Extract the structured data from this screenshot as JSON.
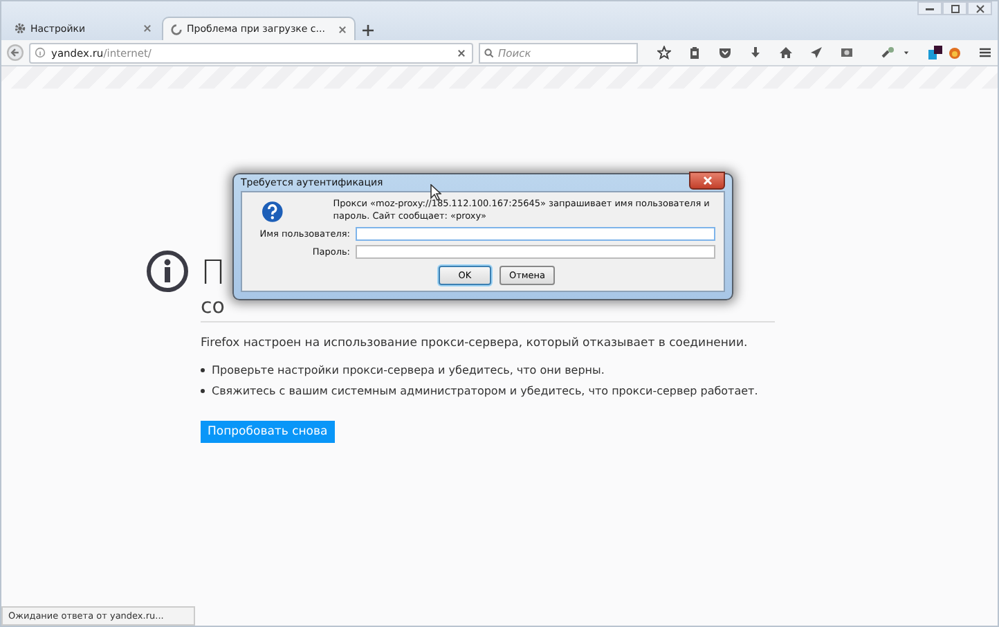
{
  "tabs": [
    {
      "title": "Настройки",
      "selected": false,
      "loading": false
    },
    {
      "title": "Проблема при загрузке с...",
      "selected": true,
      "loading": true
    }
  ],
  "address": {
    "host": "yandex.ru",
    "path": "/internet/"
  },
  "search": {
    "placeholder": "Поиск"
  },
  "page": {
    "heading": "П",
    "subheading": "со",
    "description": "Firefox настроен на использование прокси-сервера, который отказывает в соединении.",
    "tips": [
      "Проверьте настройки прокси-сервера и убедитесь, что они верны.",
      "Свяжитесь с вашим системным администратором и убедитесь, что прокси-сервер работает."
    ],
    "retry_button": "Попробовать снова"
  },
  "dialog": {
    "title": "Требуется аутентификация",
    "message": "Прокси «moz-proxy://185.112.100.167:25645» запрашивает имя пользователя и пароль. Сайт сообщает: «proxy»",
    "fields": [
      {
        "label": "Имя пользователя:",
        "focused": true
      },
      {
        "label": "Пароль:",
        "focused": false
      }
    ],
    "buttons": [
      {
        "label": "OK",
        "default": true
      },
      {
        "label": "Отмена",
        "default": false
      }
    ]
  },
  "status_bar": "Ожидание ответа от yandex.ru..."
}
